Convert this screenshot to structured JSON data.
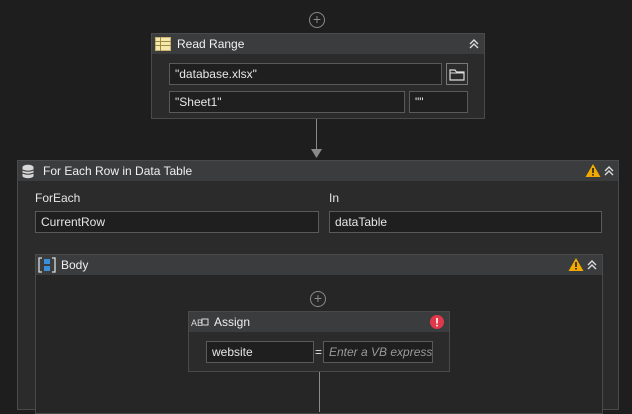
{
  "read_range": {
    "title": "Read Range",
    "workbook_value": "\"database.xlsx\"",
    "sheet_value": "\"Sheet1\"",
    "range_value": "\"\""
  },
  "for_each": {
    "title": "For Each Row in Data Table",
    "foreach_label": "ForEach",
    "foreach_value": "CurrentRow",
    "in_label": "In",
    "in_value": "dataTable"
  },
  "body": {
    "title": "Body"
  },
  "assign": {
    "title": "Assign",
    "to_value": "website",
    "equals": "=",
    "value_placeholder": "Enter a VB expressi"
  },
  "colors": {
    "warning": "#f2a900",
    "error": "#e0384b",
    "accent_blue": "#3a8fd9"
  }
}
